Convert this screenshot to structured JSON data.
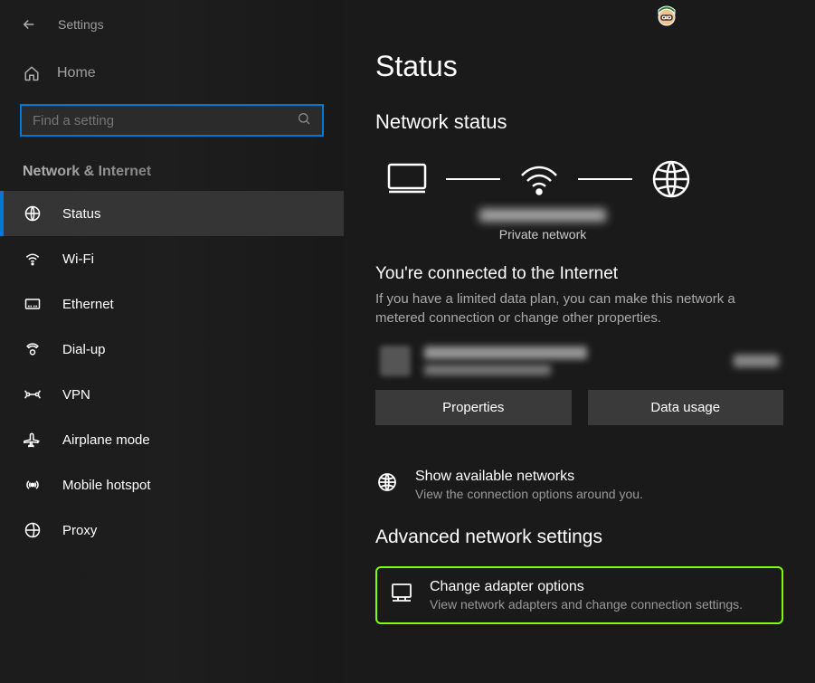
{
  "app_title": "Settings",
  "home_label": "Home",
  "search": {
    "placeholder": "Find a setting"
  },
  "section_title": "Network & Internet",
  "sidebar_items": [
    {
      "label": "Status",
      "icon": "globe-icon",
      "active": true
    },
    {
      "label": "Wi-Fi",
      "icon": "wifi-icon",
      "active": false
    },
    {
      "label": "Ethernet",
      "icon": "ethernet-icon",
      "active": false
    },
    {
      "label": "Dial-up",
      "icon": "dialup-icon",
      "active": false
    },
    {
      "label": "VPN",
      "icon": "vpn-icon",
      "active": false
    },
    {
      "label": "Airplane mode",
      "icon": "airplane-icon",
      "active": false
    },
    {
      "label": "Mobile hotspot",
      "icon": "hotspot-icon",
      "active": false
    },
    {
      "label": "Proxy",
      "icon": "proxy-icon",
      "active": false
    }
  ],
  "page_title": "Status",
  "status_heading": "Network status",
  "network_type": "Private network",
  "connected_heading": "You're connected to the Internet",
  "connected_desc": "If you have a limited data plan, you can make this network a metered connection or change other properties.",
  "buttons": {
    "properties": "Properties",
    "data_usage": "Data usage"
  },
  "show_networks": {
    "title": "Show available networks",
    "desc": "View the connection options around you."
  },
  "advanced_heading": "Advanced network settings",
  "change_adapter": {
    "title": "Change adapter options",
    "desc": "View network adapters and change connection settings."
  }
}
